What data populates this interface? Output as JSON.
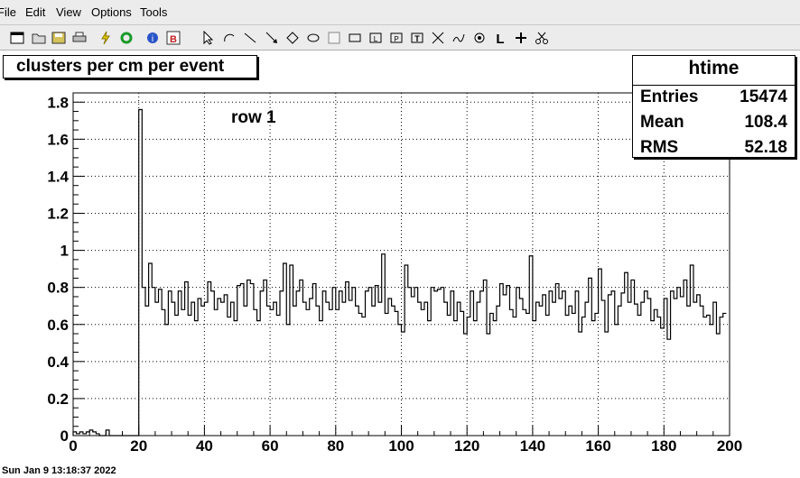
{
  "menubar": {
    "items": [
      {
        "label": "File",
        "name": "menu-file"
      },
      {
        "label": "Edit",
        "name": "menu-edit"
      },
      {
        "label": "View",
        "name": "menu-view"
      },
      {
        "label": "Options",
        "name": "menu-options"
      },
      {
        "label": "Tools",
        "name": "menu-tools"
      }
    ]
  },
  "toolbar": {
    "icons": [
      "new-canvas-icon",
      "open-folder-icon",
      "save-icon",
      "print-icon",
      "interrupt-icon",
      "refresh-icon",
      "inspect-icon",
      "browser-icon",
      "pointer-icon",
      "arc-icon",
      "line-icon",
      "arrow-icon",
      "diamond-icon",
      "ellipse-icon",
      "pad-icon",
      "pave-icon",
      "pave-label-icon",
      "pave-text-icon",
      "text-icon",
      "graph-icon",
      "curly-line-icon",
      "marker-icon",
      "latex-icon",
      "crosshair-icon",
      "cut-icon"
    ]
  },
  "titlebox": {
    "text": "clusters per cm per event"
  },
  "statsbox": {
    "title": "htime",
    "rows": [
      {
        "label": "Entries",
        "value": "15474"
      },
      {
        "label": "Mean",
        "value": "108.4"
      },
      {
        "label": "RMS",
        "value": "52.18"
      }
    ]
  },
  "datestamp": {
    "text": "Sun Jan  9 13:18:37 2022"
  },
  "chart_data": {
    "type": "histogram-step",
    "annotation": "row 1",
    "xlim": [
      0,
      200
    ],
    "ylim": [
      0,
      1.85
    ],
    "xticks": [
      0,
      20,
      40,
      60,
      80,
      100,
      120,
      140,
      160,
      180,
      200
    ],
    "yticks": [
      0,
      0.2,
      0.4,
      0.6,
      0.8,
      1,
      1.2,
      1.4,
      1.6,
      1.8
    ],
    "ytick_labels": [
      "0",
      "0.2",
      "0.4",
      "0.6",
      "0.8",
      "1",
      "1.2",
      "1.4",
      "1.6",
      "1.8"
    ],
    "grid": true,
    "bin_width": 1,
    "values": [
      0.02,
      0.01,
      0.02,
      0.01,
      0.02,
      0.03,
      0.02,
      0.01,
      0.0,
      0.0,
      0.03,
      0.0,
      0.0,
      0.0,
      0.0,
      0.0,
      0.0,
      0.0,
      0.0,
      0.0,
      1.76,
      0.8,
      0.7,
      0.93,
      0.8,
      0.72,
      0.79,
      0.68,
      0.6,
      0.78,
      0.72,
      0.65,
      0.78,
      0.68,
      0.83,
      0.65,
      0.72,
      0.62,
      0.74,
      0.7,
      0.72,
      0.83,
      0.78,
      0.68,
      0.74,
      0.72,
      0.76,
      0.64,
      0.72,
      0.62,
      0.81,
      0.82,
      0.7,
      0.84,
      0.82,
      0.68,
      0.62,
      0.78,
      0.84,
      0.7,
      0.68,
      0.72,
      0.65,
      0.78,
      0.93,
      0.6,
      0.92,
      0.7,
      0.78,
      0.84,
      0.72,
      0.68,
      0.74,
      0.82,
      0.7,
      0.62,
      0.78,
      0.72,
      0.68,
      0.8,
      0.68,
      0.78,
      0.72,
      0.83,
      0.73,
      0.8,
      0.7,
      0.66,
      0.64,
      0.78,
      0.8,
      0.7,
      0.81,
      0.72,
      0.98,
      0.66,
      0.74,
      0.7,
      0.67,
      0.6,
      0.56,
      0.92,
      0.8,
      0.75,
      0.8,
      0.72,
      0.68,
      0.72,
      0.62,
      0.8,
      0.78,
      0.79,
      0.8,
      0.72,
      0.65,
      0.78,
      0.62,
      0.72,
      0.67,
      0.55,
      0.64,
      0.78,
      0.62,
      0.72,
      0.78,
      0.84,
      0.55,
      0.66,
      0.62,
      0.7,
      0.82,
      0.76,
      0.81,
      0.68,
      0.64,
      0.8,
      0.74,
      0.68,
      0.66,
      0.97,
      0.62,
      0.72,
      0.7,
      0.76,
      0.65,
      0.78,
      0.72,
      0.82,
      0.74,
      0.78,
      0.65,
      0.7,
      0.66,
      0.78,
      0.56,
      0.64,
      0.72,
      0.85,
      0.62,
      0.66,
      0.9,
      0.73,
      0.56,
      0.76,
      0.78,
      0.6,
      0.7,
      0.77,
      0.88,
      0.72,
      0.84,
      0.71,
      0.65,
      0.72,
      0.78,
      0.74,
      0.62,
      0.68,
      0.64,
      0.58,
      0.74,
      0.52,
      0.78,
      0.74,
      0.8,
      0.75,
      0.84,
      0.7,
      0.92,
      0.72,
      0.76,
      0.7,
      0.64,
      0.65,
      0.6,
      0.72,
      0.55,
      0.64,
      0.66
    ]
  }
}
